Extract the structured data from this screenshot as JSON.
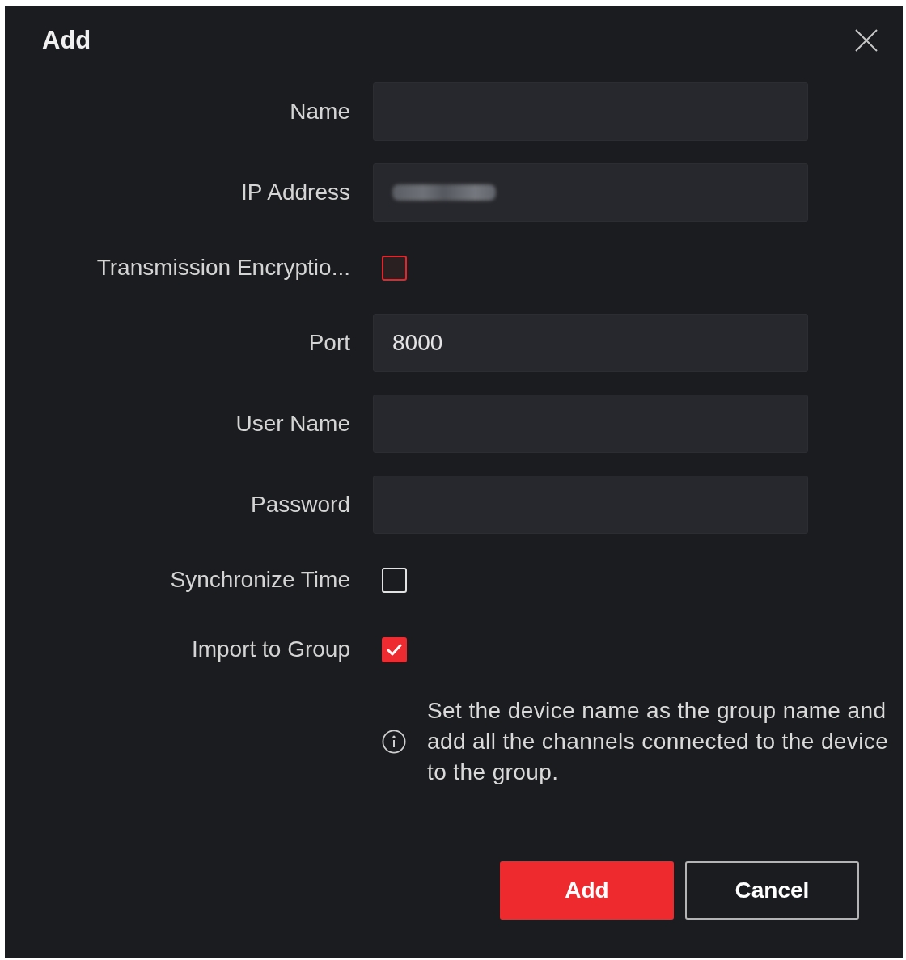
{
  "dialog": {
    "title": "Add"
  },
  "fields": [
    {
      "kind": "text",
      "label": "Name"
    },
    {
      "kind": "text",
      "label": "IP Address",
      "blurred": true
    },
    {
      "kind": "checkbox",
      "label": "Transmission Encryptio...",
      "checked": false,
      "hovered": true
    },
    {
      "kind": "text",
      "label": "Port",
      "value": "8000"
    },
    {
      "kind": "text",
      "label": "User Name"
    },
    {
      "kind": "password",
      "label": "Password"
    },
    {
      "kind": "checkbox",
      "label": "Synchronize Time",
      "checked": false
    },
    {
      "kind": "checkbox",
      "label": "Import to Group",
      "checked": true
    }
  ],
  "info_note": "Set the device name as the group name and add all the channels connected to the device to the group.",
  "buttons": [
    {
      "label": "Add",
      "kind": "primary"
    },
    {
      "label": "Cancel",
      "kind": "secondary"
    }
  ]
}
